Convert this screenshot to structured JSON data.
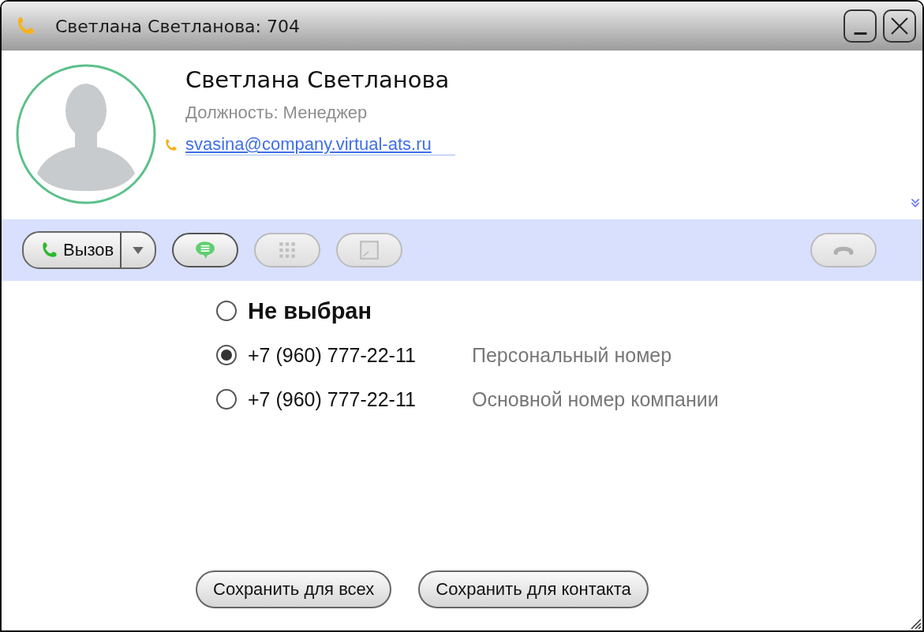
{
  "window": {
    "title": "Светлана Светланова: 704"
  },
  "contact": {
    "name": "Светлана Светланова",
    "position": "Должность: Менеджер",
    "email": "svasina@company.virtual-ats.ru"
  },
  "toolbar": [
    {
      "kind": "call",
      "label": "Вызов",
      "disabled": false
    },
    {
      "kind": "chat",
      "disabled": false
    },
    {
      "kind": "keypad",
      "disabled": true
    },
    {
      "kind": "transfer",
      "disabled": true
    },
    {
      "kind": "hangup",
      "disabled": true
    }
  ],
  "numbers": [
    {
      "number": "Не выбран",
      "selected": false
    },
    {
      "number": "+7 (960) 777-22-11",
      "note": "Персональный номер",
      "selected": true
    },
    {
      "number": "+7 (960) 777-22-11",
      "note": "Основной номер компании",
      "selected": false
    }
  ],
  "buttons": [
    "Сохранить для всех",
    "Сохранить для контакта"
  ]
}
